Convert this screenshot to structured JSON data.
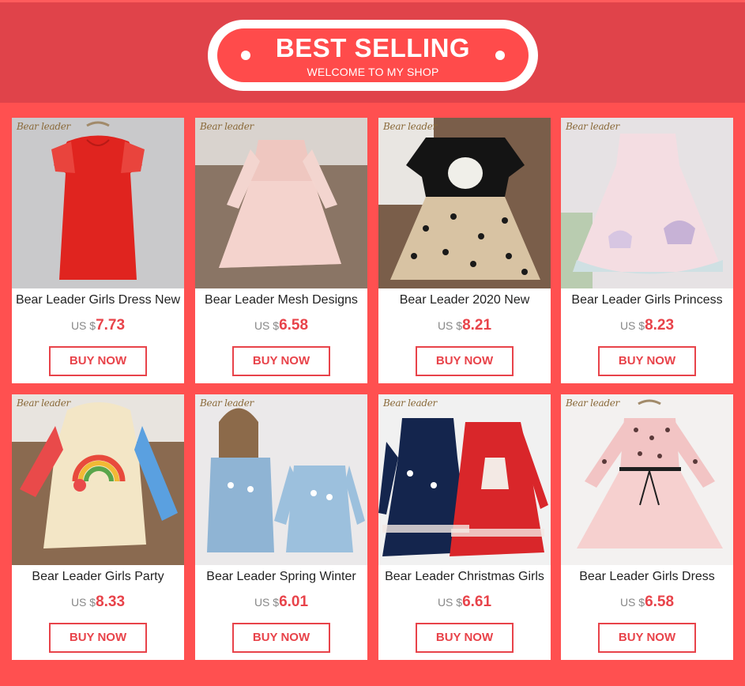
{
  "banner": {
    "title": "BEST SELLING",
    "subtitle": "WELCOME TO MY SHOP"
  },
  "brand_watermark": "Bear leader",
  "currency_label": "US $",
  "buy_label": "BUY NOW",
  "products": [
    {
      "name": "Bear Leader Girls Dress New",
      "price": "7.73",
      "image": "red sleeveless dress",
      "bg": "#c9c9cb",
      "dress": "#e0241f"
    },
    {
      "name": "Bear Leader Mesh Designs",
      "price": "6.58",
      "image": "pink long-sleeve tulle dress",
      "bg": "#8a7565",
      "dress": "#efc7c0"
    },
    {
      "name": "Bear Leader 2020 New",
      "price": "8.21",
      "image": "swan top with star tulle skirt",
      "bg": "#7a5e4a",
      "dress": "#d8c3a3"
    },
    {
      "name": "Bear Leader Girls Princess",
      "price": "8.23",
      "image": "unicorn sequin tulle dress",
      "bg": "#e6e2e4",
      "dress": "#f4dde2"
    },
    {
      "name": "Bear Leader Girls Party",
      "price": "8.33",
      "image": "rainbow hooded dress",
      "bg": "#8a6a50",
      "dress": "#f3e6c6"
    },
    {
      "name": "Bear Leader Spring Winter",
      "price": "6.01",
      "image": "girl in blue sweater dress",
      "bg": "#ebe9ea",
      "dress": "#8fb4d4"
    },
    {
      "name": "Bear Leader Christmas Girls",
      "price": "6.61",
      "image": "christmas reindeer sweater dresses",
      "bg": "#f1f1f1",
      "dress": "#d9262a"
    },
    {
      "name": "Bear Leader Girls Dress",
      "price": "6.58",
      "image": "polka dot tulle dress",
      "bg": "#f3f1f0",
      "dress": "#f2c4c4"
    }
  ]
}
